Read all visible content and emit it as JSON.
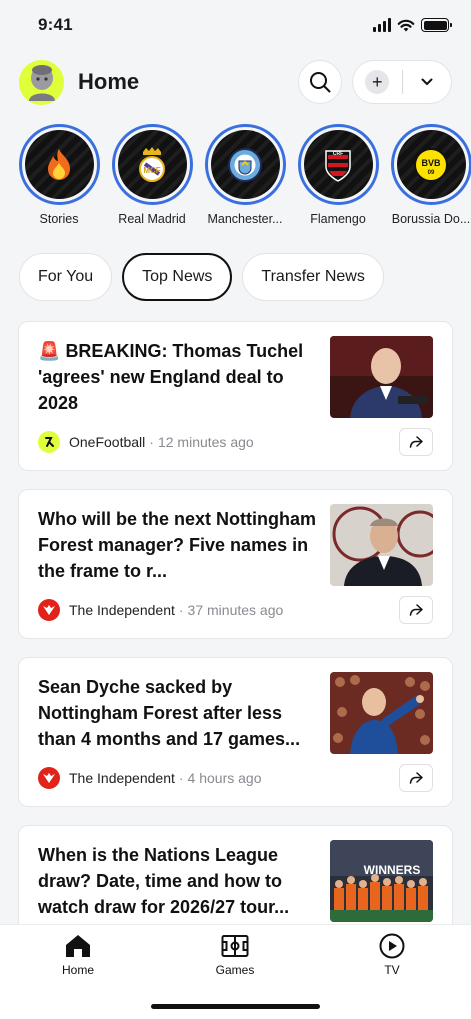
{
  "status_bar": {
    "time": "9:41"
  },
  "header": {
    "title": "Home"
  },
  "stories": [
    {
      "label": "Stories",
      "icon": "fire-icon"
    },
    {
      "label": "Real Madrid",
      "icon": "real-madrid-crest-icon"
    },
    {
      "label": "Manchester...",
      "icon": "manchester-city-crest-icon"
    },
    {
      "label": "Flamengo",
      "icon": "flamengo-crest-icon"
    },
    {
      "label": "Borussia Do...",
      "icon": "borussia-dortmund-crest-icon",
      "crest_text": "BVB 09"
    }
  ],
  "tabs": [
    {
      "label": "For You",
      "active": false
    },
    {
      "label": "Top News",
      "active": true
    },
    {
      "label": "Transfer News",
      "active": false
    }
  ],
  "articles": [
    {
      "badge": "🚨",
      "title": "BREAKING: Thomas Tuchel 'agrees' new England deal to 2028",
      "source": "OneFootball",
      "time": "12 minutes ago"
    },
    {
      "title": "Who will be the next Nottingham Forest manager? Five names in the frame to r...",
      "source": "The Independent",
      "time": "37 minutes ago"
    },
    {
      "title": "Sean Dyche sacked by Nottingham Forest after less than 4 months and 17 games...",
      "source": "The Independent",
      "time": "4 hours ago"
    },
    {
      "title": "When is the Nations League draw? Date, time and how to watch draw for 2026/27 tour...",
      "source": "",
      "time": "",
      "thumb_banner": "WINNERS"
    }
  ],
  "bottom_nav": [
    {
      "label": "Home",
      "icon": "home-icon",
      "active": true
    },
    {
      "label": "Games",
      "icon": "pitch-icon",
      "active": false
    },
    {
      "label": "TV",
      "icon": "play-icon",
      "active": false
    }
  ],
  "colors": {
    "accent_ring": "#3a6fe0",
    "avatar_bg": "#dfff3a",
    "independent_red": "#e2231a",
    "onefootball_lime": "#dfff3a"
  }
}
